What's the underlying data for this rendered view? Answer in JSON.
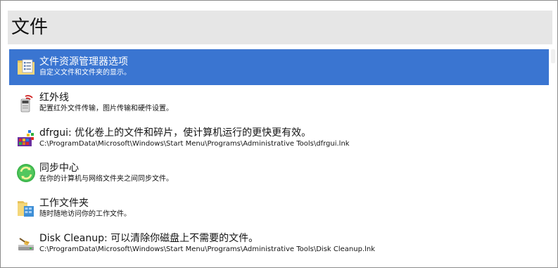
{
  "header": {
    "title": "文件"
  },
  "items": [
    {
      "title": "文件资源管理器选项",
      "subtitle": "自定义文件和文件夹的显示。",
      "icon": "folder-options-icon",
      "selected": true
    },
    {
      "title": "红外线",
      "subtitle": "配置红外文件传输，图片传输和硬件设置。",
      "icon": "infrared-icon"
    },
    {
      "title": "dfrgui: 优化卷上的文件和碎片，使计算机运行的更快更有效。",
      "subtitle": "C:\\ProgramData\\Microsoft\\Windows\\Start Menu\\Programs\\Administrative Tools\\dfrgui.lnk",
      "icon": "defrag-icon"
    },
    {
      "title": "同步中心",
      "subtitle": "在你的计算机与网络文件夹之间同步文件。",
      "icon": "sync-center-icon"
    },
    {
      "title": "工作文件夹",
      "subtitle": "随时随地访问你的工作文件。",
      "icon": "work-folders-icon"
    },
    {
      "title": "Disk Cleanup: 可以清除你磁盘上不需要的文件。",
      "subtitle": "C:\\ProgramData\\Microsoft\\Windows\\Start Menu\\Programs\\Administrative Tools\\Disk Cleanup.lnk",
      "icon": "disk-cleanup-icon"
    }
  ],
  "colors": {
    "selection": "#3a75d1",
    "header_bg": "#e6e6e6"
  }
}
